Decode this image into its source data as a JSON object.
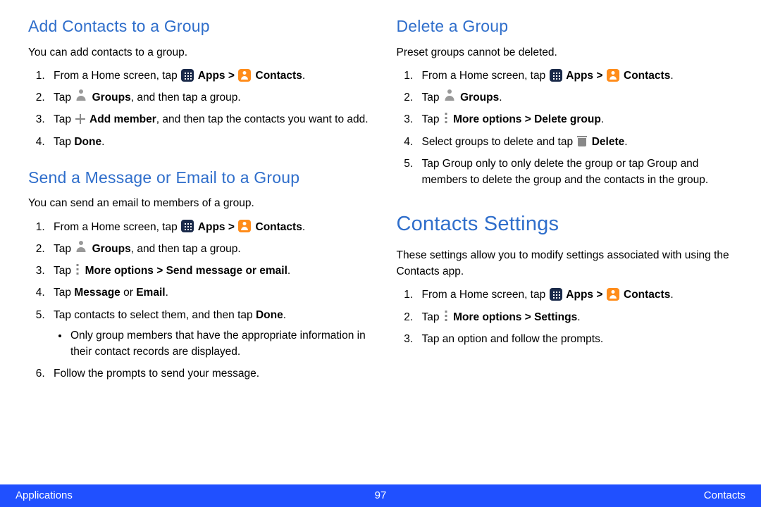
{
  "left": {
    "s1": {
      "h": "Add Contacts to a Group",
      "intro": "You can add contacts to a group.",
      "i1a": "From a Home screen, tap ",
      "i1b": " Apps > ",
      "i1c": " Contacts",
      "i1d": ".",
      "i2a": "Tap ",
      "i2b": " Groups",
      "i2c": ", and then tap a group.",
      "i3a": "Tap ",
      "i3b": " Add member",
      "i3c": ", and then tap the contacts you want to add.",
      "i4a": "Tap ",
      "i4b": "Done",
      "i4c": "."
    },
    "s2": {
      "h": "Send a Message or Email to a Group",
      "intro": "You can send an email to members of a group.",
      "i1a": "From a Home screen, tap ",
      "i1b": " Apps > ",
      "i1c": " Contacts",
      "i1d": ".",
      "i2a": "Tap ",
      "i2b": " Groups",
      "i2c": ", and then tap a group.",
      "i3a": "Tap ",
      "i3b": " More options > Send message or email",
      "i3c": ".",
      "i4a": "Tap ",
      "i4b": "Message",
      "i4c": " or ",
      "i4d": "Email",
      "i4e": ".",
      "i5a": "Tap contacts to select them, and then tap ",
      "i5b": "Done",
      "i5c": ".",
      "i5bullet": "Only group members that have the appropriate information in their contact records are displayed.",
      "i6": "Follow the prompts to send your message."
    }
  },
  "right": {
    "s1": {
      "h": "Delete a Group",
      "intro": "Preset groups cannot be deleted.",
      "i1a": "From a Home screen, tap ",
      "i1b": " Apps > ",
      "i1c": " Contacts",
      "i1d": ".",
      "i2a": "Tap ",
      "i2b": " Groups",
      "i2c": ".",
      "i3a": "Tap ",
      "i3b": " More options > Delete group",
      "i3c": ".",
      "i4a": "Select groups to delete and tap ",
      "i4b": " Delete",
      "i4c": ".",
      "i5": "Tap Group only to only delete the group or tap Group and members to delete the group and the contacts in the group."
    },
    "s2": {
      "h": "Contacts Settings",
      "intro": "These settings allow you to modify settings associated with using the Contacts app.",
      "i1a": "From a Home screen, tap ",
      "i1b": " Apps > ",
      "i1c": " Contacts",
      "i1d": ".",
      "i2a": "Tap ",
      "i2b": " More options > Settings",
      "i2c": ".",
      "i3": "Tap an option and follow the prompts."
    }
  },
  "footer": {
    "left": "Applications",
    "center": "97",
    "right": "Contacts"
  }
}
